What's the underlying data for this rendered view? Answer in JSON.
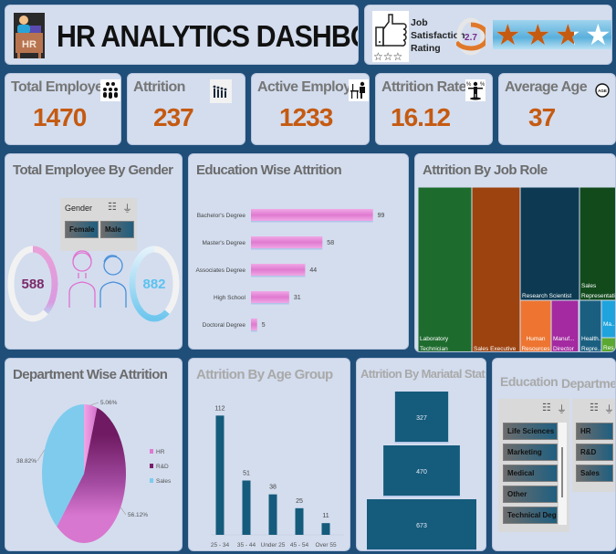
{
  "header": {
    "title": "HR ANALYTICS DASHBOARD",
    "logo_text": "HR"
  },
  "job_satisfaction": {
    "label_line1": "Job",
    "label_line2": "Satisfaction",
    "label_line3": "Rating",
    "rating": "2.7",
    "rating_value": 2.7,
    "rating_max": 4,
    "stars_total": 4,
    "colors": {
      "filled": "#c55a11",
      "empty": "#ffffff"
    }
  },
  "kpis": [
    {
      "label": "Total Employee",
      "value": "1470",
      "icon": "people-group-icon",
      "glyph": "⚈"
    },
    {
      "label": "Attrition",
      "value": "237",
      "icon": "people-leaving-icon",
      "glyph": "⚉"
    },
    {
      "label": "Active Employee",
      "value": "1233",
      "icon": "desk-worker-icon",
      "glyph": "⚇"
    },
    {
      "label": "Attrition Rate",
      "value": "16.12",
      "icon": "percent-person-icon",
      "glyph": "%"
    },
    {
      "label": "Average Age",
      "value": "37",
      "icon": "age-icon",
      "glyph": "AGE"
    }
  ],
  "gender": {
    "title": "Total Employee By Gender",
    "slicer_label": "Gender",
    "slicer_options": [
      "Female",
      "Male"
    ],
    "female_value": "588",
    "male_value": "882",
    "female_count": 588,
    "male_count": 882,
    "total": 1470,
    "colors": {
      "female": "#e8a0d8",
      "male": "#6ec6ee",
      "female_text": "#7b2a6a",
      "male_text": "#5bc2f0"
    }
  },
  "chart_data": [
    {
      "id": "education",
      "type": "bar",
      "orientation": "horizontal",
      "title": "Education Wise Attrition",
      "categories": [
        "Bachelor's Degree",
        "Master's Degree",
        "Associates Degree",
        "High School",
        "Doctoral Degree"
      ],
      "values": [
        99,
        58,
        44,
        31,
        5
      ],
      "data_labels": [
        "99",
        "58",
        "44",
        "31",
        "5"
      ],
      "xlim": [
        0,
        100
      ],
      "grid": false,
      "color": "#e07ad0"
    },
    {
      "id": "jobrole",
      "type": "treemap",
      "title": "Attrition By Job Role",
      "items": [
        {
          "label": "Laboratory Technician",
          "line1": "Laboratory",
          "line2": "Technician",
          "color": "#1e6b2e"
        },
        {
          "label": "Sales Executive",
          "line1": "",
          "line2": "Sales Executive",
          "color": "#9c4310"
        },
        {
          "label": "Research Scientist",
          "line1": "",
          "line2": "Research Scientist",
          "color": "#0d3a52"
        },
        {
          "label": "Sales Representative",
          "line1": "Sales",
          "line2": "Representative",
          "color": "#124a1c"
        },
        {
          "label": "Human Resources",
          "line1": "Human",
          "line2": "Resources",
          "color": "#ed7531"
        },
        {
          "label": "Manufacturing Director",
          "line1": "Manuf...",
          "line2": "Director",
          "color": "#a32aa0"
        },
        {
          "label": "Healthcare Representative",
          "line1": "Health...",
          "line2": "Repre...",
          "color": "#1b5f80"
        },
        {
          "label": "Manager",
          "line1": "Ma...",
          "line2": "",
          "color": "#1ea3dc"
        },
        {
          "label": "Research Director",
          "line1": "Res...",
          "line2": "",
          "color": "#5aa832"
        }
      ]
    },
    {
      "id": "department",
      "type": "pie",
      "title": "Department Wise Attrition",
      "categories": [
        "HR",
        "R&D",
        "Sales"
      ],
      "values": [
        5.06,
        56.12,
        38.82
      ],
      "data_labels": [
        "5.06%",
        "56.12%",
        "38.82%"
      ],
      "legend": "right",
      "colors": [
        "#e07ad0",
        "#7a1f6a",
        "#7ecbee"
      ]
    },
    {
      "id": "age",
      "type": "bar",
      "title": "Attrition By Age Group",
      "categories": [
        "25 - 34",
        "35 - 44",
        "Under 25",
        "45 - 54",
        "Over 55"
      ],
      "values": [
        112,
        51,
        38,
        25,
        11
      ],
      "data_labels": [
        "112",
        "51",
        "38",
        "25",
        "11"
      ],
      "ylim": [
        0,
        120
      ],
      "grid": false,
      "color": "#155b7c"
    },
    {
      "id": "marital",
      "type": "funnel",
      "title": "Attrition By Mariatal Status",
      "values": [
        327,
        470,
        673
      ],
      "data_labels": [
        "327",
        "470",
        "673"
      ],
      "color": "#155b7c"
    }
  ],
  "slicers": {
    "education": {
      "title": "Education",
      "options": [
        "Life Sciences",
        "Marketing",
        "Medical",
        "Other",
        "Technical Deg..."
      ]
    },
    "department": {
      "title": "Department",
      "options": [
        "HR",
        "R&D",
        "Sales"
      ]
    }
  }
}
